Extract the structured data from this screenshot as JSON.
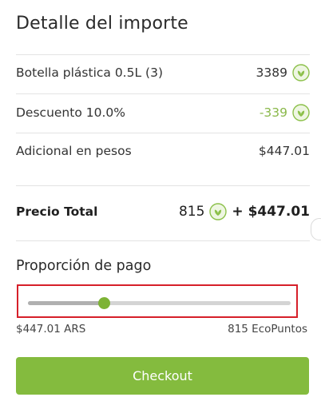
{
  "panel": {
    "title": "Detalle del importe"
  },
  "items": [
    {
      "label": "Botella plástica 0.5L (3)",
      "value": "3389",
      "has_leaf": true,
      "negative": false
    },
    {
      "label": "Descuento 10.0%",
      "value": "-339",
      "has_leaf": true,
      "negative": true
    },
    {
      "label": "Adicional en pesos",
      "value": "$447.01",
      "has_leaf": false,
      "negative": false
    }
  ],
  "total": {
    "label": "Precio Total",
    "points": "815",
    "money": "+ $447.01"
  },
  "payment": {
    "title": "Proporción de pago",
    "slider_value_fraction": 0.29,
    "min_label": "$447.01 ARS",
    "max_label": "815 EcoPuntos"
  },
  "checkout": {
    "label": "Checkout"
  },
  "icons": {
    "points_icon": "leaf-coin-icon"
  },
  "colors": {
    "accent_green": "#84bb3e",
    "thumb_green": "#7db335",
    "negative_green": "#8ab84a",
    "highlight_red": "#d6202a"
  }
}
